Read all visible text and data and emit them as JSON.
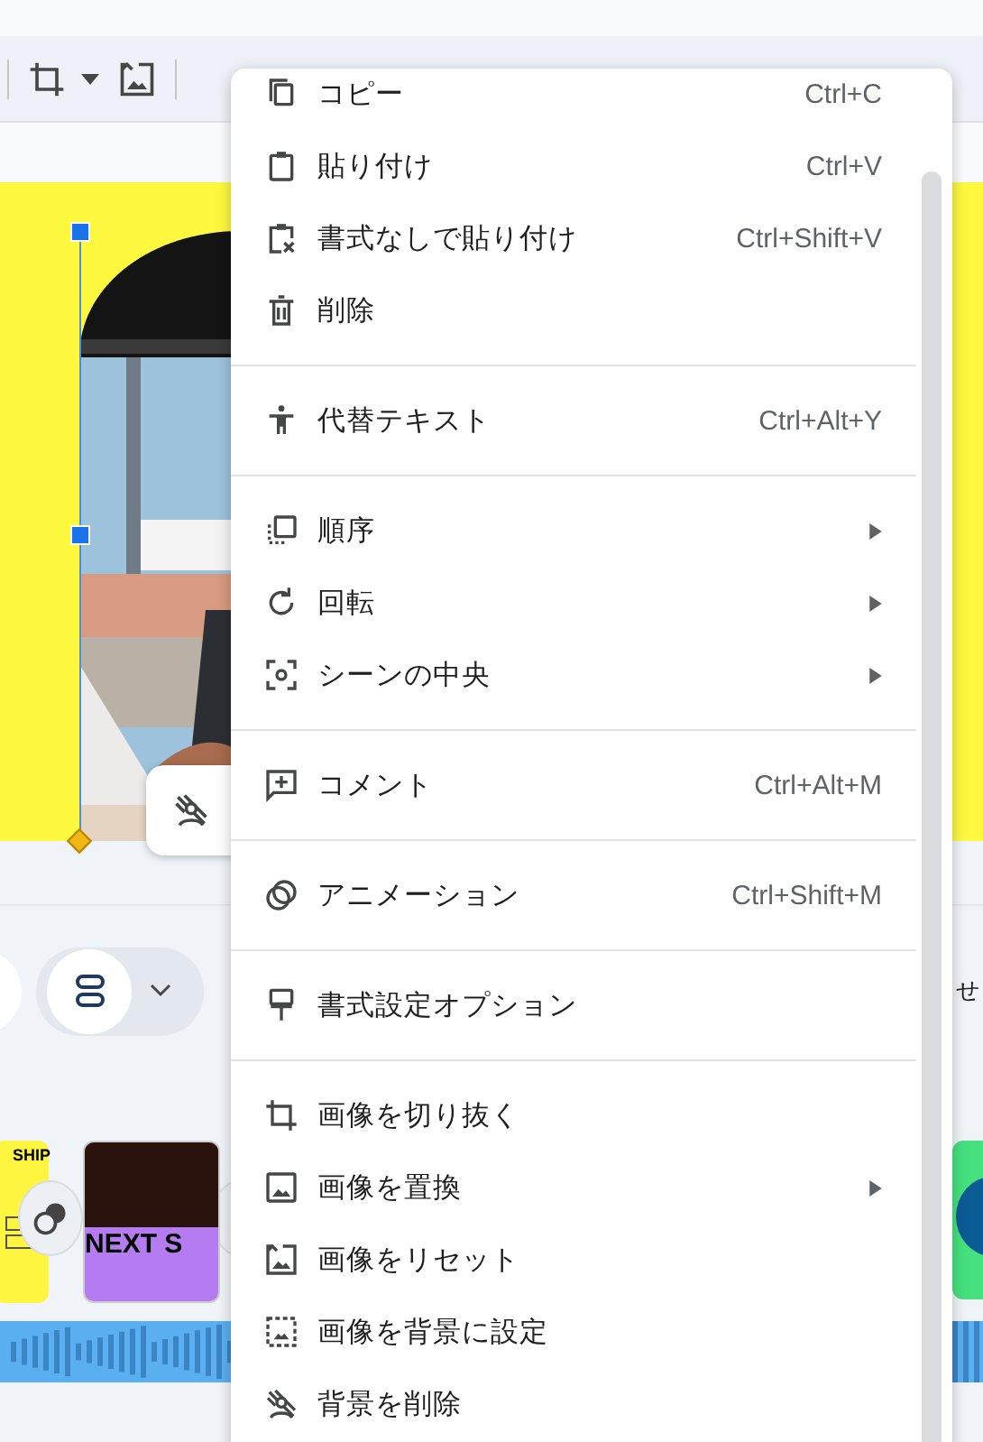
{
  "bottom": {
    "side_text": "せ"
  },
  "filmstrip": [
    {
      "title": "SHIP",
      "color": "#fdf53f"
    },
    {
      "title": "NEXT S",
      "color": "#b57cf2"
    }
  ],
  "menu": {
    "sections": [
      [
        {
          "label": "コピー",
          "shortcut": "Ctrl+C",
          "submenu": false
        },
        {
          "label": "貼り付け",
          "shortcut": "Ctrl+V",
          "submenu": false
        },
        {
          "label": "書式なしで貼り付け",
          "shortcut": "Ctrl+Shift+V",
          "submenu": false
        },
        {
          "label": "削除",
          "submenu": false
        }
      ],
      [
        {
          "label": "代替テキスト",
          "shortcut": "Ctrl+Alt+Y",
          "submenu": false
        }
      ],
      [
        {
          "label": "順序",
          "submenu": true
        },
        {
          "label": "回転",
          "submenu": true
        },
        {
          "label": "シーンの中央",
          "submenu": true
        }
      ],
      [
        {
          "label": "コメント",
          "shortcut": "Ctrl+Alt+M",
          "submenu": false
        }
      ],
      [
        {
          "label": "アニメーション",
          "shortcut": "Ctrl+Shift+M",
          "submenu": false
        }
      ],
      [
        {
          "label": "書式設定オプション",
          "submenu": false
        }
      ],
      [
        {
          "label": "画像を切り抜く",
          "submenu": false
        },
        {
          "label": "画像を置換",
          "submenu": true
        },
        {
          "label": "画像をリセット",
          "submenu": false
        },
        {
          "label": "画像を背景に設定",
          "submenu": false
        },
        {
          "label": "背景を削除",
          "submenu": false
        }
      ]
    ]
  }
}
